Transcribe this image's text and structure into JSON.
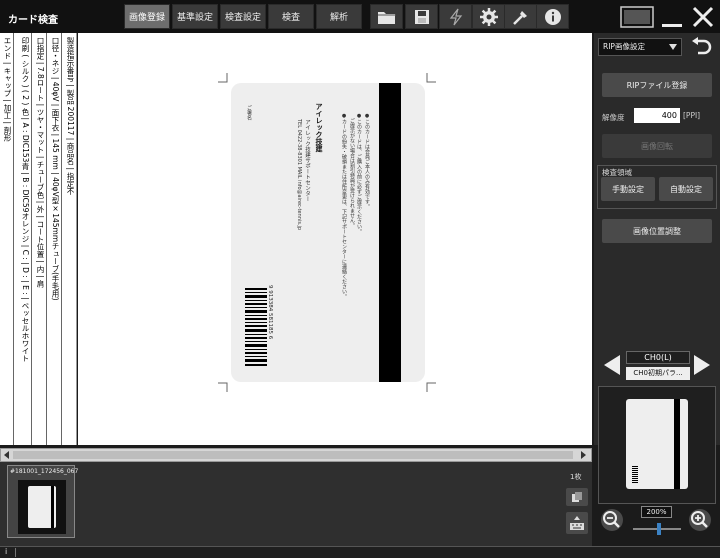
{
  "app": {
    "title": "カード検査"
  },
  "nav_tabs": [
    "画像登録",
    "基準設定",
    "検査設定",
    "検査",
    "解析"
  ],
  "sheet": {
    "columns": [
      "製造指示番号 | 製品 200117 | 商品名 | 指定不",
      "口径・ネジ | 40φV | 面下衣 | 145 mm | 40φV型×145mmチューブ(手毛用)",
      "口指定 | 7.8ロート | ツヤ・マット | チューブ色 | 外 | コート位置 | 内 | 肩",
      "印刷 ( シルク ) ( 2 ) 色 | A : DIC153青 | B : DIC59オレンジ | C : | D : | E : | ベッセルホワイト",
      "エンド | キャップ | 加工 | 剤形"
    ]
  },
  "card": {
    "brand": "アイレック技建",
    "lines": [
      "●このカードは会員ご本人のみ有効です。",
      "●このカードは、ご購入の前に必ずご提示ください。",
      "　ご提示がない場合は割引特典が受けられません。",
      "●カードの紛失・破損または住所変更は、下記サポートセンターに連絡ください。",
      "アイレック技建サポートセンター",
      "TEL 0422-38-8301 MAIL info@airec-tennis.jp"
    ],
    "side_note": "ご署名",
    "barcode_number": "9 913384 581185 6"
  },
  "right_panel": {
    "rip_select": "RIP画像設定",
    "rip_register": "RIPファイル登録",
    "resolution_label": "解像度",
    "resolution_value": "400",
    "resolution_unit": "[PPI]",
    "rotate": "画像回転",
    "inspect_area": "検査領域",
    "manual_set": "手動設定",
    "auto_set": "自動設定",
    "position_adjust": "画像位置調整"
  },
  "channel": {
    "name": "CH0(L)",
    "preset": "CH0初期パラ..."
  },
  "zoom": {
    "level": "200%",
    "slider_pct": 55
  },
  "filmstrip": {
    "thumb_label": "#181001_172456_067",
    "count": "1枚"
  },
  "status": {
    "text": "i"
  },
  "colors": {
    "bg": "#1b1b1b",
    "active_tab": "#6d6d6d",
    "panel": "#2a2a2a"
  }
}
